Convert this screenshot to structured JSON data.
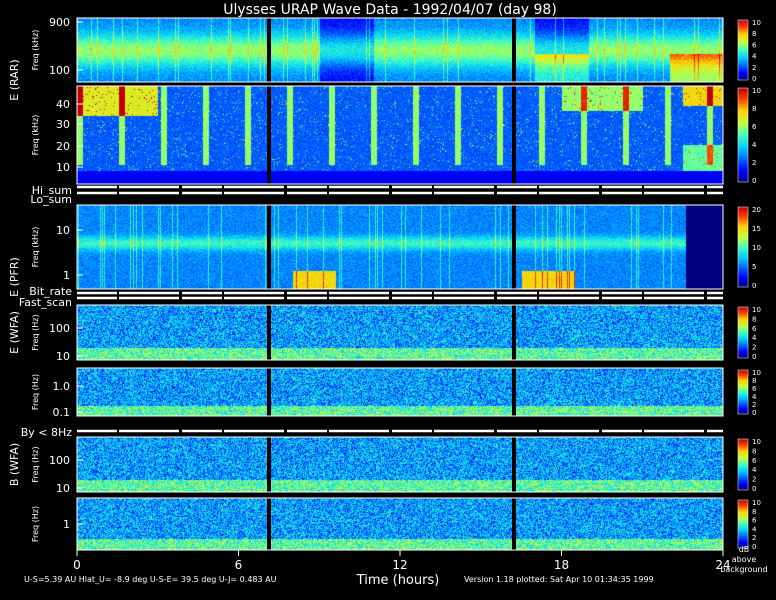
{
  "chart_data": {
    "type": "heatmap",
    "title": "Ulysses URAP Wave Data - 1992/04/07  (day 98)",
    "xlabel": "Time (hours)",
    "x_ticks": [
      "0",
      "6",
      "12",
      "18",
      "24"
    ],
    "xlim": [
      0,
      24
    ],
    "panels": [
      {
        "id": "rar",
        "ylabel": "E (RAR)",
        "y_unit": "Freq (kHz)",
        "yticks": [
          "900",
          "100"
        ],
        "scale": "log",
        "colorbar_ticks": [
          "10",
          "8",
          "6",
          "4",
          "2",
          "0"
        ],
        "colorbar_range": [
          0,
          10
        ]
      },
      {
        "id": "rar-low",
        "ylabel": "",
        "y_unit": "Freq (kHz)",
        "yticks": [
          "40",
          "30",
          "20",
          "10"
        ],
        "scale": "linear",
        "colorbar_ticks": [
          "10",
          "8",
          "6",
          "4",
          "2",
          "0"
        ],
        "colorbar_range": [
          0,
          10
        ]
      },
      {
        "id": "pfr",
        "ylabel": "E (PFR)",
        "y_unit": "Freq (kHz)",
        "yticks": [
          "10",
          "1"
        ],
        "scale": "log",
        "colorbar_ticks": [
          "20",
          "15",
          "10",
          "5",
          "0"
        ],
        "colorbar_range": [
          0,
          20
        ]
      },
      {
        "id": "wfa-e-high",
        "ylabel": "E (WFA)",
        "y_unit": "Freq (Hz)",
        "yticks": [
          "100",
          "10"
        ],
        "scale": "log",
        "colorbar_ticks": [
          "10",
          "8",
          "6",
          "4",
          "2",
          "0"
        ],
        "colorbar_range": [
          0,
          10
        ]
      },
      {
        "id": "wfa-e-low",
        "ylabel": "",
        "y_unit": "Freq (Hz)",
        "yticks": [
          "1.0",
          "0.1"
        ],
        "scale": "log",
        "colorbar_ticks": [
          "10",
          "8",
          "6",
          "4",
          "2",
          "0"
        ],
        "colorbar_range": [
          0,
          10
        ]
      },
      {
        "id": "wfa-b-high",
        "ylabel": "B (WFA)",
        "y_unit": "Freq (Hz)",
        "yticks": [
          "100",
          "10"
        ],
        "scale": "log",
        "colorbar_ticks": [
          "10",
          "8",
          "6",
          "4",
          "2",
          "0"
        ],
        "colorbar_range": [
          0,
          10
        ]
      },
      {
        "id": "wfa-b-low",
        "ylabel": "",
        "y_unit": "Freq (Hz)",
        "yticks": [
          "1"
        ],
        "scale": "log",
        "colorbar_ticks": [
          "10",
          "8",
          "6",
          "4",
          "2",
          "0"
        ],
        "colorbar_range": [
          0,
          10
        ]
      }
    ],
    "status_strips": [
      "Hi_sum",
      "Lo_sum",
      "Bit_rate",
      "Fast_scan",
      "By < 8Hz"
    ],
    "colorbar_caption": [
      "dB",
      "above",
      "background"
    ],
    "footer_left": "U-S=5.39 AU   Hlat_U= -8.9 deg   U-S-E= 39.5 deg   U-J= 0.483 AU",
    "footer_right": "Version 1.18 plotted: Sat Apr 10 01:34:35 1999"
  }
}
